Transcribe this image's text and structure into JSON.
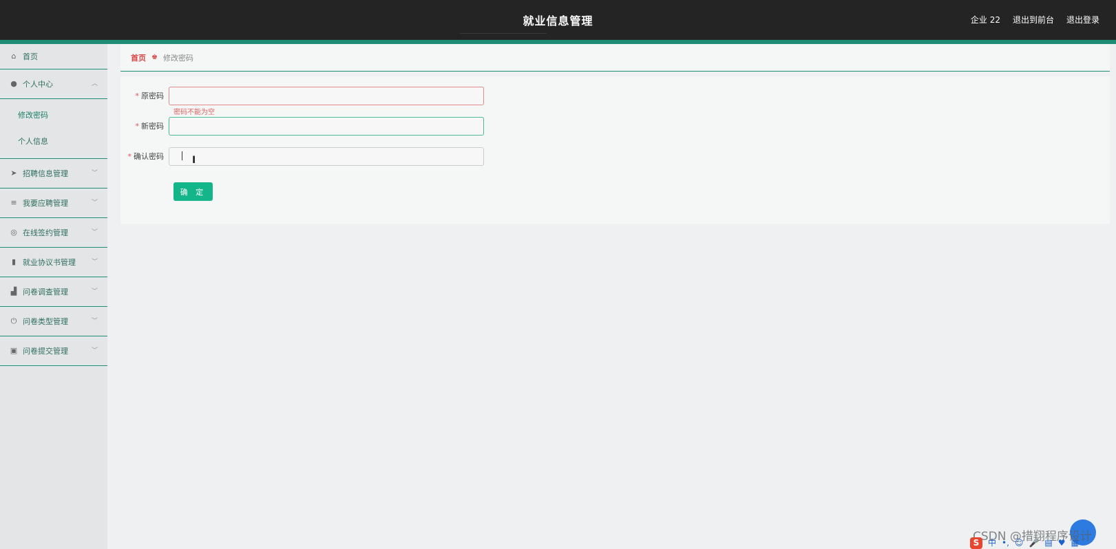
{
  "header": {
    "title": "就业信息管理",
    "user": "企业 22",
    "to_frontend": "退出到前台",
    "logout": "退出登录"
  },
  "sidebar": {
    "home": "首页",
    "personal_center": {
      "label": "个人中心",
      "children": [
        "修改密码",
        "个人信息"
      ]
    },
    "items": [
      "招聘信息管理",
      "我要应聘管理",
      "在线签约管理",
      "就业协议书管理",
      "问卷调查管理",
      "问卷类型管理",
      "问卷提交管理"
    ]
  },
  "breadcrumb": {
    "home": "首页",
    "current": "修改密码"
  },
  "form": {
    "required_mark": "*",
    "old_password_label": "原密码",
    "old_password_value": "",
    "old_password_error": "密码不能为空",
    "new_password_label": "新密码",
    "new_password_value": "",
    "confirm_password_label": "确认密码",
    "confirm_password_value": "",
    "submit_label": "确 定"
  },
  "watermark": "CSDN @措翔程序设计",
  "ime": {
    "s": "S",
    "lang": "中",
    "punct": "•,",
    "emoji": "☺",
    "mic": "🎤",
    "keyboard": "▤",
    "skin": "♥",
    "grid": "▦"
  },
  "colors": {
    "accent": "#1f8c75",
    "button": "#15b58a",
    "error": "#e06262",
    "header_bg": "#242424"
  }
}
